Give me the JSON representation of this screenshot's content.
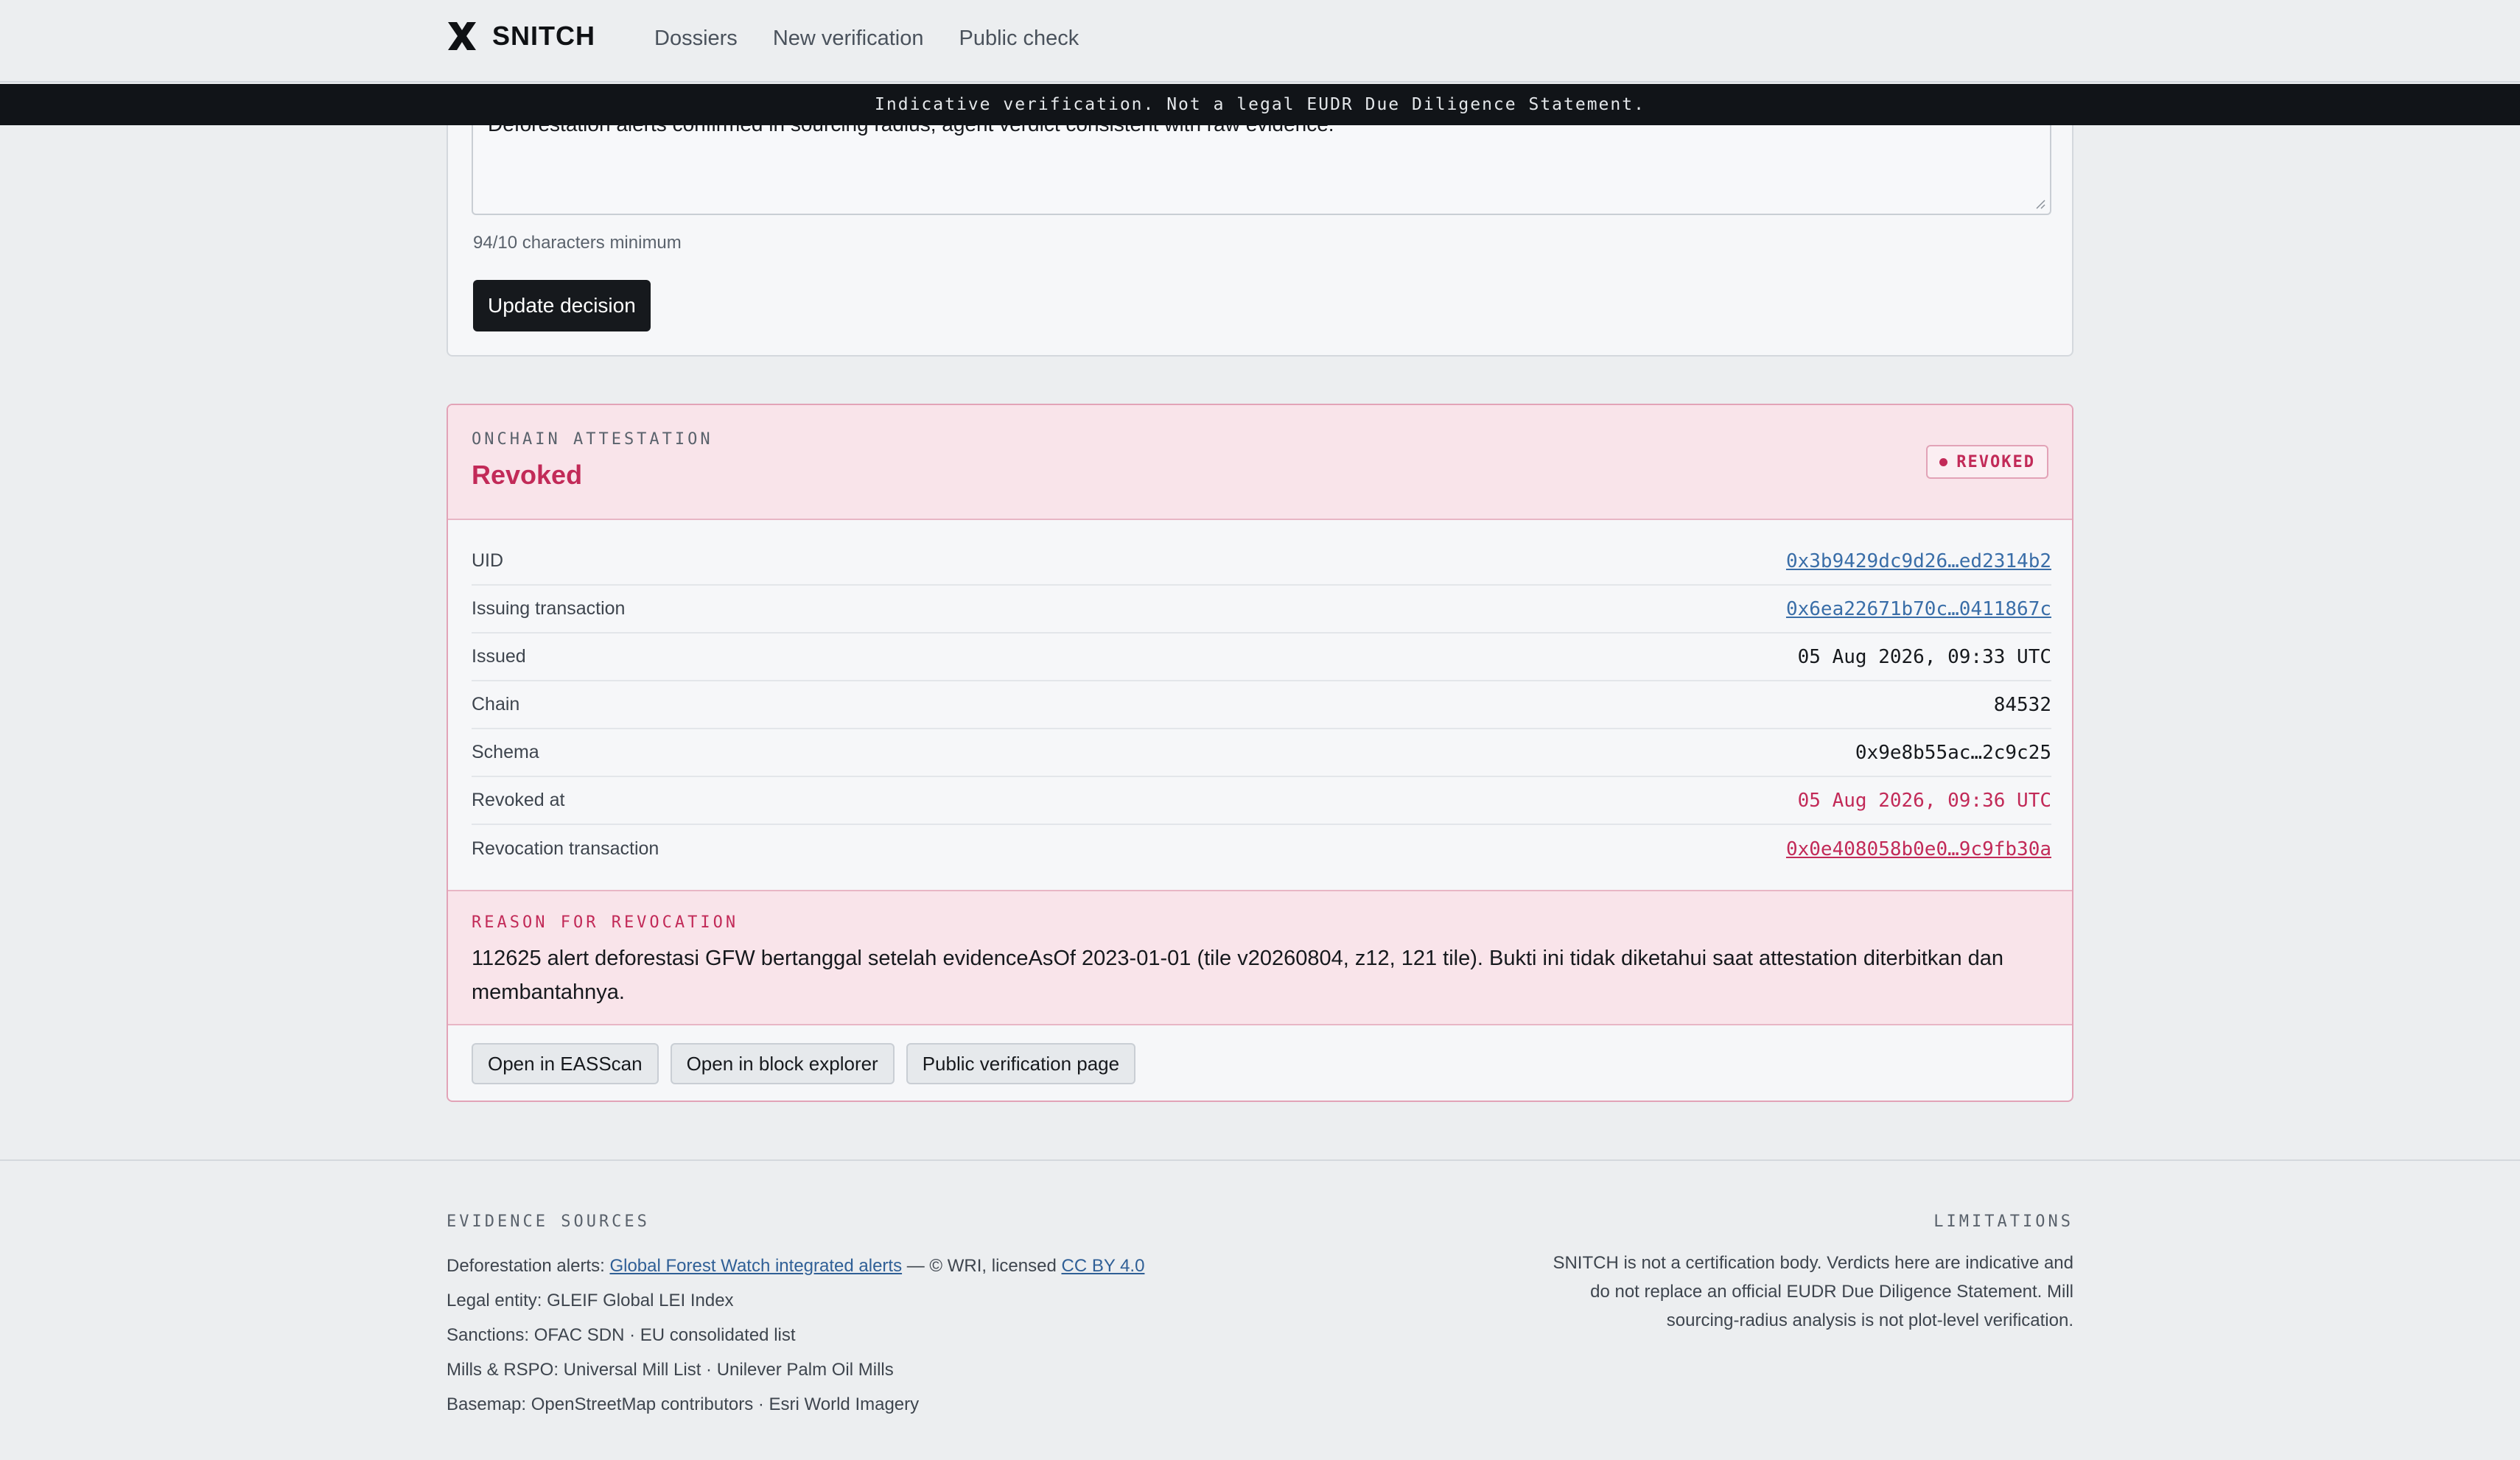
{
  "nav": {
    "brand": "SNITCH",
    "links": [
      "Dossiers",
      "New verification",
      "Public check"
    ]
  },
  "banner": "Indicative verification. Not a legal EUDR Due Diligence Statement.",
  "decision": {
    "notes_value": "Deforestation alerts confirmed in sourcing radius, agent verdict consistent with raw evidence.",
    "char_count": "94/10 characters minimum",
    "update_label": "Update decision"
  },
  "attestation": {
    "eyebrow": "ONCHAIN ATTESTATION",
    "title": "Revoked",
    "badge": "REVOKED",
    "rows": [
      {
        "label": "UID",
        "value": "0x3b9429dc9d26…ed2314b2"
      },
      {
        "label": "Issuing transaction",
        "value": "0x6ea22671b70c…0411867c"
      },
      {
        "label": "Issued",
        "value": "05 Aug 2026, 09:33 UTC"
      },
      {
        "label": "Chain",
        "value": "84532"
      },
      {
        "label": "Schema",
        "value": "0x9e8b55ac…2c9c25"
      },
      {
        "label": "Revoked at",
        "value": "05 Aug 2026, 09:36 UTC"
      },
      {
        "label": "Revocation transaction",
        "value": "0x0e408058b0e0…9c9fb30a"
      }
    ],
    "reason_eyebrow": "REASON FOR REVOCATION",
    "reason_text": "112625 alert deforestasi GFW bertanggal setelah evidenceAsOf 2023-01-01 (tile v20260804, z12, 121 tile). Bukti ini tidak diketahui saat attestation diterbitkan dan membantahnya.",
    "actions": [
      "Open in EASScan",
      "Open in block explorer",
      "Public verification page"
    ]
  },
  "footer": {
    "sources_eyebrow": "EVIDENCE SOURCES",
    "deforestation_prefix": "Deforestation alerts:",
    "deforestation_link": "Global Forest Watch integrated alerts",
    "deforestation_mid": "— © WRI, licensed",
    "license_link": "CC BY 4.0",
    "legal_entity": "Legal entity: GLEIF Global LEI Index",
    "sanctions": "Sanctions: OFAC SDN · EU consolidated list",
    "mills": "Mills & RSPO: Universal Mill List · Unilever Palm Oil Mills",
    "basemap": "Basemap: OpenStreetMap contributors · Esri World Imagery",
    "limitations_eyebrow": "LIMITATIONS",
    "limitations_text": "SNITCH is not a certification body. Verdicts here are indicative and do not replace an official EUDR Due Diligence Statement. Mill sourcing-radius analysis is not plot-level verification."
  }
}
